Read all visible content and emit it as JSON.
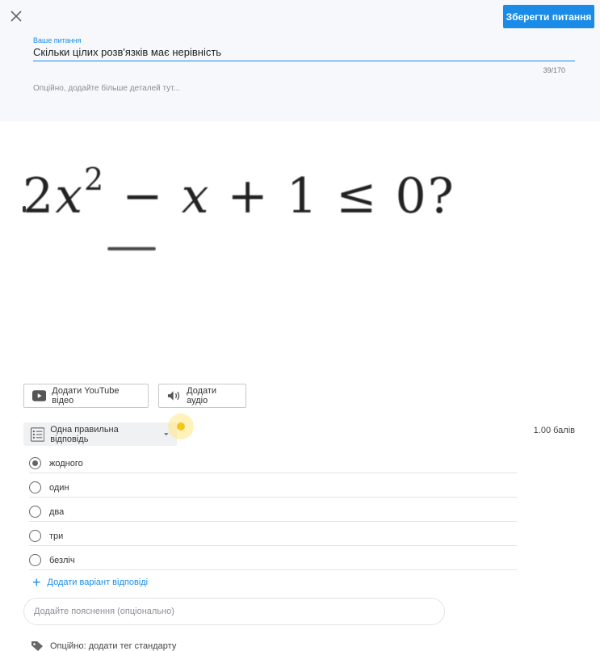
{
  "header": {
    "save_label": "Зберегти питання"
  },
  "question": {
    "label": "Ваше питання",
    "value": "Скільки цілих розв'язків має нерівність",
    "counter": "39/170",
    "details_placeholder": "Опційно, додайте більше деталей тут..."
  },
  "formula": {
    "coef": "2",
    "var": "x",
    "exp": "2",
    "rest": " − ",
    "var2": "x",
    "tail": " + 1 ≤ 0?"
  },
  "media": {
    "youtube_label": "Додати YouTube відео",
    "audio_label": "Додати аудіо"
  },
  "answer_type": {
    "selected": "Одна правильна відповідь",
    "points": "1.00 балів"
  },
  "options": [
    {
      "label": "жодного",
      "checked": true
    },
    {
      "label": "один",
      "checked": false
    },
    {
      "label": "два",
      "checked": false
    },
    {
      "label": "три",
      "checked": false
    },
    {
      "label": "безліч",
      "checked": false
    }
  ],
  "add_answer_label": "Додати варіант відповіді",
  "explanation_placeholder": "Додайте пояснення (опціонально)",
  "tag_label": "Опційно: додати тег стандарту",
  "colors": {
    "accent": "#1a8ce8",
    "panel_bg": "#f6f8fb",
    "highlight": "#f5c518"
  },
  "icons": {
    "close": "close-icon",
    "youtube": "youtube-icon",
    "audio": "speaker-icon",
    "list": "list-icon",
    "caret": "chevron-down-icon",
    "plus": "plus-icon",
    "tag": "tag-icon"
  }
}
